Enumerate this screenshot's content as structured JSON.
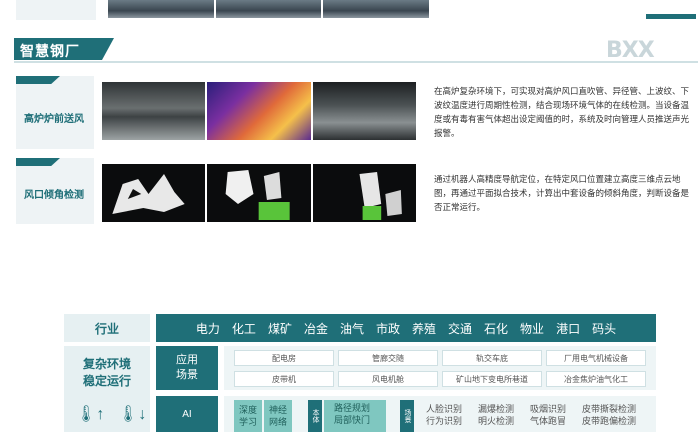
{
  "section": {
    "title": "智慧钢厂",
    "logo_text": "BXX"
  },
  "features": [
    {
      "label": "高炉炉前送风",
      "description": "在高炉复杂环境下，可实现对高炉风口直吹管、异径管、上波纹、下波纹温度进行周期性检测，结合现场环境气体的在线检测。当设备温度或有毒有害气体超出设定阈值的时，系统及时向管理人员推送声光报警。"
    },
    {
      "label": "风口倾角检测",
      "description": "通过机器人高精度导航定位，在特定风口位置建立高度三维点云地图，再通过平面拟合技术，计算出中套设备的倾斜角度，判断设备是否正常运行。"
    }
  ],
  "table": {
    "industry_label": "行业",
    "industries": [
      "电力",
      "化工",
      "煤矿",
      "冶金",
      "油气",
      "市政",
      "养殖",
      "交通",
      "石化",
      "物业",
      "港口",
      "码头"
    ],
    "env_label": "复杂环境\n稳定运行",
    "scene_label": "应用\n场景",
    "scenes": [
      "配电房",
      "管廊交随",
      "轨交车底",
      "厂用电气机械设备",
      "皮带机",
      "风电机舱",
      "矿山地下变电所巷道",
      "冶金焦炉油气化工"
    ],
    "ai_label": "AI",
    "ai_cells": [
      "深度\n学习",
      "神经\n网络"
    ],
    "body_tab": "本体",
    "body_items": [
      "路径规划",
      "局部快门"
    ],
    "scene_tab": "场景",
    "detections": [
      "人脸识别",
      "漏爆检测",
      "吸烟识别",
      "皮带撕裂检测",
      "行为识别",
      "明火检测",
      "气体跑冒",
      "皮带跑偏检测"
    ]
  }
}
